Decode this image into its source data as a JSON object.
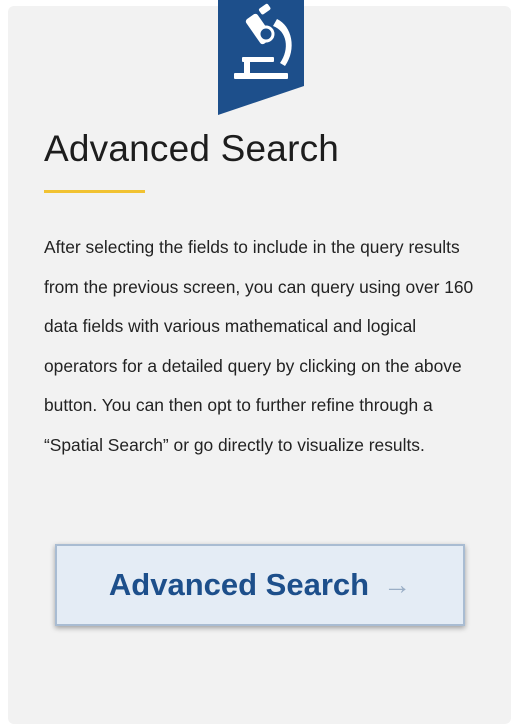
{
  "card": {
    "icon": "microscope-icon",
    "title": "Advanced Search",
    "description": "After selecting the fields to include in the query results from the previous screen, you can query using over 160 data fields with various mathematical and logical operators for a detailed query by clicking on the above button. You can then opt to further refine through a “Spatial Search” or go directly to visualize results.",
    "button_label": "Advanced Search",
    "button_icon": "arrow-right-icon"
  },
  "colors": {
    "banner": "#1d4f8b",
    "accent_underline": "#f1c232",
    "button_text": "#1d4f8b",
    "button_background": "#e4ecf5"
  }
}
